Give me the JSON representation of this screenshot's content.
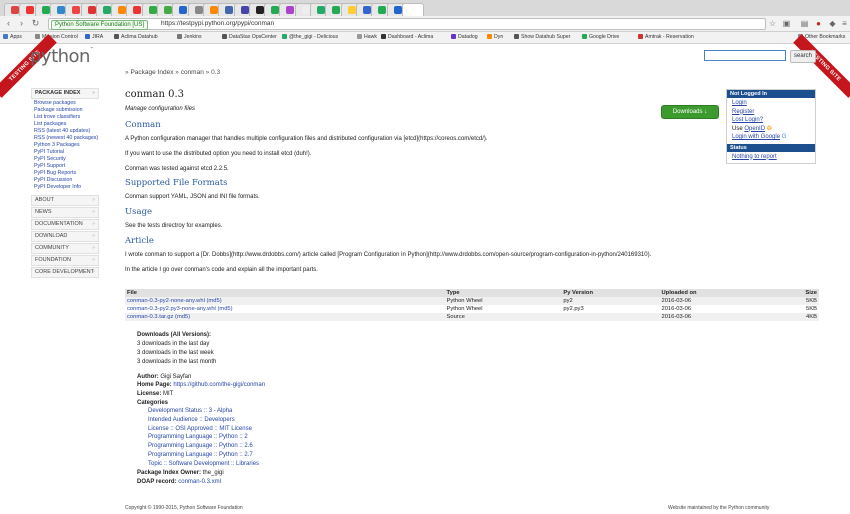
{
  "browser": {
    "secure_label": "Python Software Foundation [US]",
    "url": "https://testpypi.python.org/pypi/conman",
    "bookmarks": [
      "Apps",
      "Mission Control",
      "JIRA",
      "Aclima Datahub",
      "Jenkins",
      "DataStax OpsCenter",
      "@the_gigi - Delicious",
      "Hawk",
      "Dashboard - Aclima",
      "Datadog",
      "Dyn",
      "Show Datahub Super",
      "Google Drive",
      "Amtrak - Reservation",
      "Other Bookmarks"
    ],
    "tab_colors": [
      "#d44",
      "#e33",
      "#2a5",
      "#38c",
      "#e44",
      "#d33",
      "#2a6",
      "#f80",
      "#e33",
      "#3a4",
      "#4a4",
      "#26c",
      "#888",
      "#f80",
      "#46a",
      "#44a",
      "#222",
      "#2a5",
      "#a4c",
      "#eee",
      "#2a6",
      "#2a5",
      "#fc3",
      "#36c",
      "#2a5",
      "#26c"
    ]
  },
  "ribbon": "TESTING SITE",
  "logo": "python",
  "search": {
    "button": "search"
  },
  "breadcrumb": {
    "sep": "»",
    "items": [
      "Package Index",
      "conman",
      "0.3"
    ]
  },
  "leftnav": {
    "head": "PACKAGE INDEX",
    "links": [
      "Browse packages",
      "Package submission",
      "List trove classifiers",
      "List packages",
      "RSS (latest 40 updates)",
      "RSS (newest 40 packages)",
      "Python 3 Packages",
      "PyPI Tutorial",
      "PyPI Security",
      "PyPI Support",
      "PyPI Bug Reports",
      "PyPI Discussion",
      "PyPI Developer Info"
    ],
    "sections": [
      "ABOUT",
      "NEWS",
      "DOCUMENTATION",
      "DOWNLOAD",
      "COMMUNITY",
      "FOUNDATION",
      "CORE DEVELOPMENT"
    ]
  },
  "main": {
    "title": "conman 0.3",
    "summary": "Manage configuration files",
    "download_btn": "Downloads ↓",
    "h_conman": "Conman",
    "p1": "A Python configuration manager that handles multiple configuration files and distributed configuration via [etcd](https://coreos.com/etcd/).",
    "p2": "If you want to use the distributed option you need to install etcd (duh!).",
    "p3": "Conman was tested against etcd 2.2.5.",
    "h_formats": "Supported File Formats",
    "p4": "Conman support YAML, JSON and INI file formats.",
    "h_usage": "Usage",
    "p5": "See the tests directroy for examples.",
    "h_article": "Article",
    "p6": "I wrote conman to support a [Dr. Dobbs](http://www.drdobbs.com/) article called [Program Configuration in Python](http://www.drdobbs.com/open-source/program-configuration-in-python/240169310).",
    "p7": "In the article I go over conman's code and explain all the important parts."
  },
  "files": {
    "headers": [
      "File",
      "Type",
      "Py Version",
      "Uploaded on",
      "Size"
    ],
    "rows": [
      {
        "file": "conman-0.3-py2-none-any.whl",
        "md5": "(md5)",
        "type": "Python Wheel",
        "py": "py2",
        "date": "2016-03-06",
        "size": "5KB"
      },
      {
        "file": "conman-0.3-py2.py3-none-any.whl",
        "md5": "(md5)",
        "type": "Python Wheel",
        "py": "py2.py3",
        "date": "2016-03-06",
        "size": "5KB"
      },
      {
        "file": "conman-0.3.tar.gz",
        "md5": "(md5)",
        "type": "Source",
        "py": "",
        "date": "2016-03-06",
        "size": "4KB"
      }
    ]
  },
  "downloads": {
    "label": "Downloads (All Versions):",
    "day": "3 downloads in the last day",
    "week": "3 downloads in the last week",
    "month": "3 downloads in the last month"
  },
  "meta": {
    "author_label": "Author:",
    "author": "Gigi Sayfan",
    "home_label": "Home Page:",
    "home": "https://github.com/the-gigi/conman",
    "license_label": "License:",
    "license": "MIT",
    "categories_label": "Categories",
    "categories": [
      "Development Status :: 3 - Alpha",
      "Intended Audience :: Developers",
      "License :: OSI Approved :: MIT License",
      "Programming Language :: Python :: 2",
      "Programming Language :: Python :: 2.6",
      "Programming Language :: Python :: 2.7",
      "Topic :: Software Development :: Libraries"
    ],
    "owner_label": "Package Index Owner:",
    "owner": "the_gigi",
    "doap_label": "DOAP record:",
    "doap": "conman-0.3.xml"
  },
  "sidebar": {
    "not_logged_in": "Not Logged In",
    "login": "Login",
    "register": "Register",
    "lost_login": "Lost Login?",
    "use_openid_prefix": "Use",
    "openid": "OpenID",
    "login_google": "Login with Google",
    "status": "Status",
    "nothing": "Nothing to report"
  },
  "footer": {
    "left": "Copyright © 1990-2015, Python Software Foundation",
    "right": "Website maintained by the Python community"
  }
}
